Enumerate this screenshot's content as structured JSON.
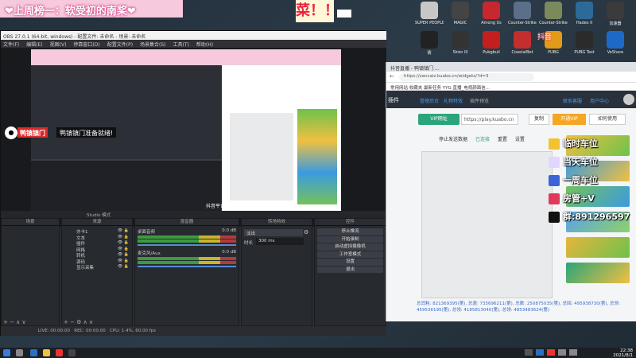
{
  "overlay": {
    "banner": "❤上周榜一：软受初的南桨❤",
    "tag": "菜！！",
    "cam_label_red": "鸭镇镇门",
    "cam_label_dark": "鸭镇镇门准备就绪!",
    "circle_text": "●",
    "douyin": "抖音",
    "rank_items": [
      {
        "label": "临时车位",
        "color": "#f2c230"
      },
      {
        "label": "当天车位",
        "color": "#e0d6ff"
      },
      {
        "label": "一周车位",
        "color": "#3a64d8"
      },
      {
        "label": "房管+V",
        "color": "#e03a5a"
      },
      {
        "label": "群:891296597",
        "color": "#111111"
      }
    ]
  },
  "desktop_icons": [
    {
      "label": "SUPER PEOPLE CBT",
      "color": "#c7c7c7"
    },
    {
      "label": "MAGIC",
      "color": "#444"
    },
    {
      "label": "Among Us",
      "color": "#c6282d"
    },
    {
      "label": "Counter-Strike Global Offe...",
      "color": "#5b6e8a"
    },
    {
      "label": "Counter-Strike Global Offe...",
      "color": "#7b8a5a"
    },
    {
      "label": "Hades II",
      "color": "#2c6a9a"
    },
    {
      "label": "加速器",
      "color": "#3b3b3b"
    },
    {
      "label": "赛",
      "color": "#222"
    },
    {
      "label": "Siren III",
      "color": "#333"
    },
    {
      "label": "Pubgbuil",
      "color": "#c41f1f"
    },
    {
      "label": "CoastalBet",
      "color": "#c42e2e"
    },
    {
      "label": "PUBG",
      "color": "#e29a1a"
    },
    {
      "label": "PUBG Test",
      "color": "#2b2b2b"
    },
    {
      "label": "VeShare",
      "color": "#1c6ac6"
    }
  ],
  "obs": {
    "title": "OBS 27.0.1 (64-bit, windows) - 配置文件: 未命名 - 场景: 未命名",
    "menu": [
      "文件(F)",
      "编辑(E)",
      "视图(V)",
      "停靠窗口(D)",
      "配置文件(P)",
      "场景集合(S)",
      "工具(T)",
      "帮助(H)"
    ],
    "preview_overlay": "抖音平台开播检测",
    "studio_toggle": "Studio 模式",
    "scenes_header": "场景",
    "sources_header": "来源",
    "sources": [
      "亦卡1",
      "文本",
      "插件",
      "网格",
      "转机",
      "源码",
      "显示采集"
    ],
    "mixer_header": "混音器",
    "mixer": [
      {
        "name": "桌面音频",
        "db": "0.0 dB"
      },
      {
        "name": "麦克风/Aux",
        "db": "0.0 dB"
      }
    ],
    "transition_header": "转场特效",
    "transition_type": "淡出",
    "duration_label": "时长",
    "duration_value": "300 ms",
    "controls_header": "控件",
    "controls": [
      "停止推流",
      "开始录制",
      "启动虚拟摄像机",
      "工作室模式",
      "设置",
      "退出"
    ],
    "status": {
      "live": "LIVE: 00:00:00",
      "rec": "REC: 00:00:00",
      "cpu": "CPU: 1.4%, 60.00 fps"
    }
  },
  "browser": {
    "tab": "抖音直播 - 鸭镇镇门 ...",
    "address": "https://zancaiz.kuabo.cn/widgets/?d=3",
    "bookmarks": "常用网站   收藏夹   最新任务   YYG 直播_电视颜面信...",
    "site_nav": [
      "插件",
      "管理后台",
      "礼物特效",
      "插件预览"
    ],
    "site_links": [
      "联系客服",
      "用户中心"
    ],
    "vip_button": "VIP网址",
    "url_value": "https://play.kuabo.cn",
    "copy_label": "复制",
    "open_vip": "开通VIP",
    "howto": "如何使用",
    "tools": [
      "停止发送数据",
      "已连接",
      "重置",
      "设置"
    ],
    "stats": "总消耗: 821369395(第), 总邀: 735696211(第), 总数: 250875035(第), 总回: 495938730(第), 总领: 459536195(第), 总领: 4185813040(第), 总领: 4853483624(第)"
  },
  "taskbar": {
    "time": "22:38",
    "date": "2021/8/1"
  }
}
